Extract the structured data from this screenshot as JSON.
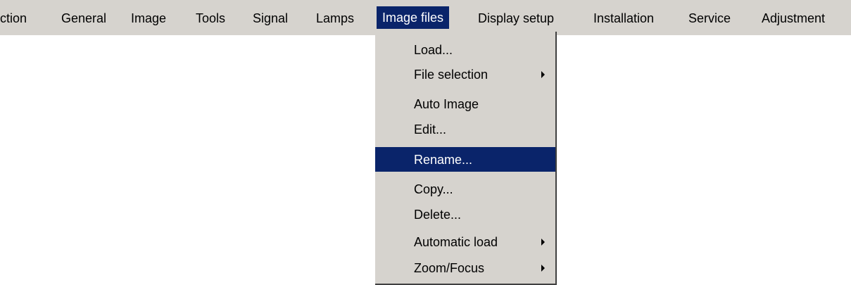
{
  "menubar": {
    "items": [
      {
        "label": "ction"
      },
      {
        "label": "General"
      },
      {
        "label": "Image"
      },
      {
        "label": "Tools"
      },
      {
        "label": "Signal"
      },
      {
        "label": "Lamps"
      },
      {
        "label": "Image files",
        "active": true
      },
      {
        "label": "Display setup"
      },
      {
        "label": "Installation"
      },
      {
        "label": "Service"
      },
      {
        "label": "Adjustment"
      }
    ]
  },
  "dropdown": {
    "items": [
      {
        "label": "Load...",
        "submenu": false
      },
      {
        "label": "File selection",
        "submenu": true
      },
      {
        "label": "Auto Image",
        "submenu": false
      },
      {
        "label": "Edit...",
        "submenu": false
      },
      {
        "label": "Rename...",
        "submenu": false,
        "highlighted": true
      },
      {
        "label": "Copy...",
        "submenu": false
      },
      {
        "label": "Delete...",
        "submenu": false
      },
      {
        "label": "Automatic load",
        "submenu": true
      },
      {
        "label": "Zoom/Focus",
        "submenu": true
      }
    ]
  },
  "colors": {
    "menu_background": "#d6d3ce",
    "highlight": "#0a246a",
    "highlight_text": "#ffffff",
    "text": "#000000"
  }
}
